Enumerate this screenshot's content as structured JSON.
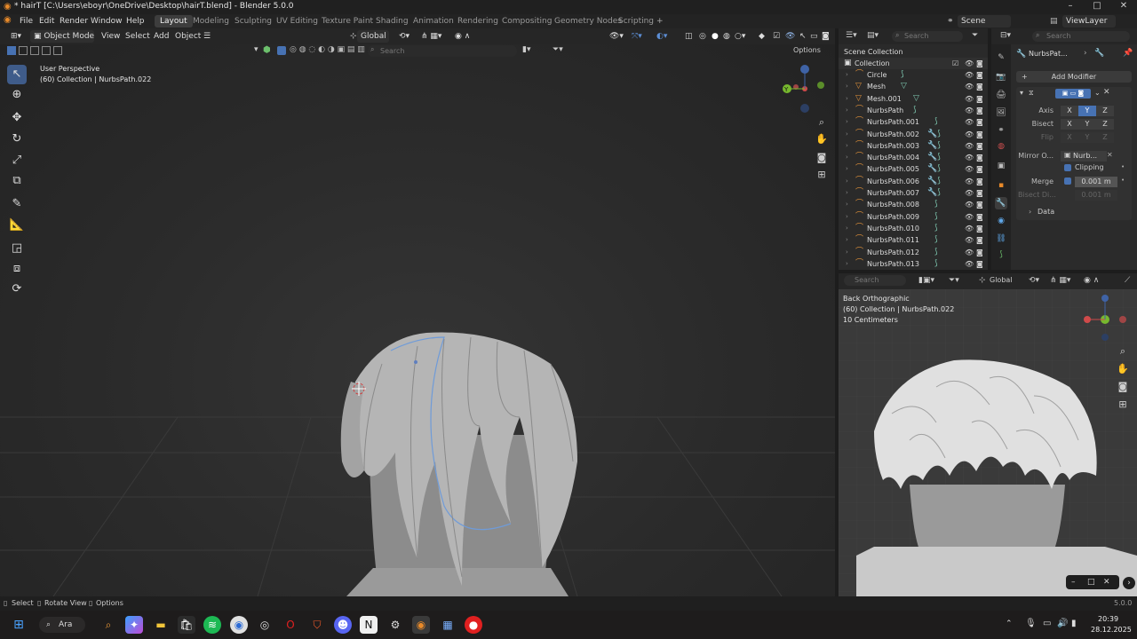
{
  "window": {
    "title": "* hairT [C:\\Users\\eboyr\\OneDrive\\Desktop\\hairT.blend] - Blender 5.0.0",
    "controls": [
      "–",
      "□",
      "✕"
    ]
  },
  "menu": {
    "items": [
      "File",
      "Edit",
      "Render",
      "Window",
      "Help"
    ],
    "workspaces": [
      "Layout",
      "Modeling",
      "Sculpting",
      "UV Editing",
      "Texture Paint",
      "Shading",
      "Animation",
      "Rendering",
      "Compositing",
      "Geometry Nodes",
      "Scripting"
    ],
    "active_workspace": "Layout",
    "scene": "Scene",
    "view_layer": "ViewLayer"
  },
  "viewport_header": {
    "mode": "Object Mode",
    "menus": [
      "View",
      "Select",
      "Add",
      "Object"
    ],
    "transform": "Global",
    "search_placeholder": "Search",
    "options": "Options"
  },
  "viewport": {
    "perspective": "User Perspective",
    "collection": "(60) Collection | NurbsPath.022"
  },
  "outliner": {
    "title": "Scene Collection",
    "search_placeholder": "Search",
    "collection": "Collection",
    "items": [
      {
        "name": "Circle",
        "icon": "curve-icon",
        "mod": "curve-data-icon"
      },
      {
        "name": "Mesh",
        "icon": "mesh-icon",
        "mod": "mesh-data-icon"
      },
      {
        "name": "Mesh.001",
        "icon": "mesh-icon",
        "mod": "mesh-data-icon"
      },
      {
        "name": "NurbsPath",
        "icon": "curve-icon",
        "mod": "curve-data-icon"
      },
      {
        "name": "NurbsPath.001",
        "icon": "curve-icon",
        "mod": "curve-data-icon"
      },
      {
        "name": "NurbsPath.002",
        "icon": "curve-icon",
        "mod": "wrench-curve-icon"
      },
      {
        "name": "NurbsPath.003",
        "icon": "curve-icon",
        "mod": "wrench-curve-icon"
      },
      {
        "name": "NurbsPath.004",
        "icon": "curve-icon",
        "mod": "wrench-curve-icon"
      },
      {
        "name": "NurbsPath.005",
        "icon": "curve-icon",
        "mod": "wrench-curve-icon"
      },
      {
        "name": "NurbsPath.006",
        "icon": "curve-icon",
        "mod": "wrench-curve-icon"
      },
      {
        "name": "NurbsPath.007",
        "icon": "curve-icon",
        "mod": "wrench-curve-icon"
      },
      {
        "name": "NurbsPath.008",
        "icon": "curve-icon",
        "mod": "curve-data-icon"
      },
      {
        "name": "NurbsPath.009",
        "icon": "curve-icon",
        "mod": "curve-data-icon"
      },
      {
        "name": "NurbsPath.010",
        "icon": "curve-icon",
        "mod": "curve-data-icon"
      },
      {
        "name": "NurbsPath.011",
        "icon": "curve-icon",
        "mod": "curve-data-icon"
      },
      {
        "name": "NurbsPath.012",
        "icon": "curve-icon",
        "mod": "curve-data-icon"
      },
      {
        "name": "NurbsPath.013",
        "icon": "curve-icon",
        "mod": "curve-data-icon"
      }
    ]
  },
  "properties": {
    "object_name": "NurbsPat...",
    "search_placeholder": "Search",
    "add_modifier": "Add Modifier",
    "axis_label": "Axis",
    "bisect_label": "Bisect",
    "flip_label": "Flip",
    "axes": [
      "X",
      "Y",
      "Z"
    ],
    "axis_active": "Y",
    "mirror_object_label": "Mirror O...",
    "mirror_object_value": "Nurb...",
    "clipping_label": "Clipping",
    "merge_label": "Merge",
    "merge_value": "0.001 m",
    "bisect_distance_label": "Bisect Di...",
    "bisect_distance_value": "0.001 m",
    "data_label": "Data"
  },
  "viewport2": {
    "transform": "Global",
    "search_placeholder": "Search",
    "view_name": "Back Orthographic",
    "collection": "(60) Collection | NurbsPath.022",
    "scale": "10 Centimeters"
  },
  "status": {
    "select": "Select",
    "rotate": "Rotate View",
    "options": "Options",
    "version": "5.0.0"
  },
  "taskbar": {
    "search": "Ara",
    "time": "20:39",
    "date": "28.12.2025"
  },
  "colors": {
    "accent": "#4772b3",
    "active_tab": "#3d3d3d",
    "curve": "#e0913a"
  }
}
